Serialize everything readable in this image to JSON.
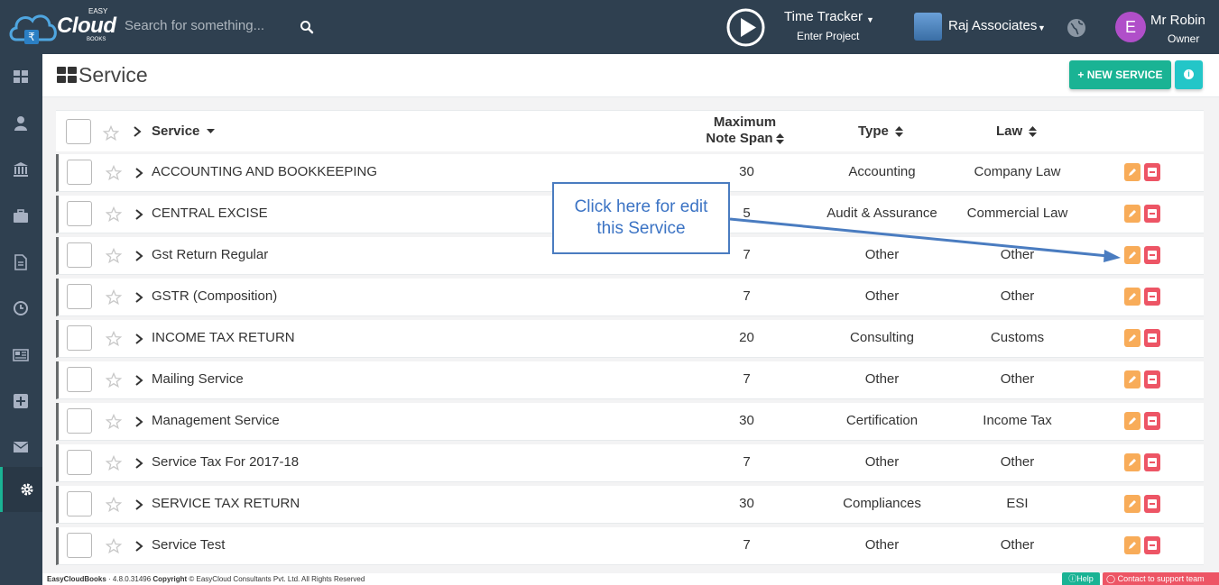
{
  "brand": {
    "easy": "EASY",
    "name": "Cloud",
    "books": "BOOKS"
  },
  "search": {
    "placeholder": "Search for something..."
  },
  "time_tracker": {
    "title": "Time Tracker",
    "subtitle": "Enter Project"
  },
  "org": {
    "name": "Raj Associates"
  },
  "user": {
    "initial": "E",
    "name": "Mr Robin",
    "role": "Owner"
  },
  "sidebar": {
    "items": [
      {
        "icon": "dashboard-icon"
      },
      {
        "icon": "user-icon"
      },
      {
        "icon": "bank-icon"
      },
      {
        "icon": "briefcase-icon"
      },
      {
        "icon": "document-icon"
      },
      {
        "icon": "clock-icon"
      },
      {
        "icon": "newspaper-icon"
      },
      {
        "icon": "plus-square-icon"
      },
      {
        "icon": "envelope-icon"
      },
      {
        "icon": "gear-icon",
        "active": true
      }
    ]
  },
  "page": {
    "title": "Service",
    "new_button": "+ NEW SERVICE"
  },
  "table": {
    "headers": {
      "service": "Service",
      "span_line1": "Maximum",
      "span_line2": "Note Span",
      "type": "Type",
      "law": "Law"
    },
    "rows": [
      {
        "name": "ACCOUNTING AND BOOKKEEPING",
        "span": "30",
        "type": "Accounting",
        "law": "Company Law"
      },
      {
        "name": "CENTRAL EXCISE",
        "span": "5",
        "type": "Audit & Assurance",
        "law": "Commercial Law"
      },
      {
        "name": "Gst Return Regular",
        "span": "7",
        "type": "Other",
        "law": "Other"
      },
      {
        "name": "GSTR (Composition)",
        "span": "7",
        "type": "Other",
        "law": "Other"
      },
      {
        "name": "INCOME TAX RETURN",
        "span": "20",
        "type": "Consulting",
        "law": "Customs"
      },
      {
        "name": "Mailing Service",
        "span": "7",
        "type": "Other",
        "law": "Other"
      },
      {
        "name": "Management Service",
        "span": "30",
        "type": "Certification",
        "law": "Income Tax"
      },
      {
        "name": "Service Tax For 2017-18",
        "span": "7",
        "type": "Other",
        "law": "Other"
      },
      {
        "name": "SERVICE TAX RETURN",
        "span": "30",
        "type": "Compliances",
        "law": "ESI"
      },
      {
        "name": "Service Test",
        "span": "7",
        "type": "Other",
        "law": "Other"
      }
    ]
  },
  "callout": {
    "line1": "Click here for edit",
    "line2": "this Service"
  },
  "footer": {
    "app": "EasyCloudBooks",
    "version": " · 4.8.0.31496 ",
    "copyright_label": "Copyright",
    "copyright_text": " © EasyCloud Consultants Pvt. Ltd. All Rights Reserved",
    "help": "Help",
    "support": "Contact to support team"
  },
  "colors": {
    "topbar": "#2f4050",
    "accent": "#1ab394",
    "info": "#23c6c8",
    "edit": "#f8ac59",
    "delete": "#ed5565",
    "callout": "#3b73c4"
  }
}
